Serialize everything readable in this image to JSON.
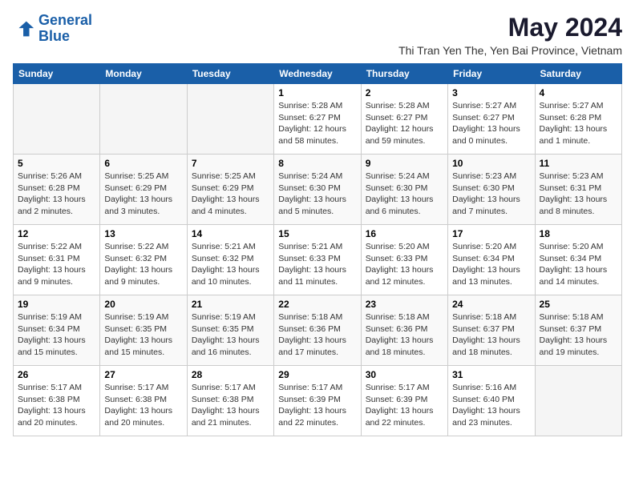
{
  "logo": {
    "line1": "General",
    "line2": "Blue"
  },
  "title": "May 2024",
  "location": "Thi Tran Yen The, Yen Bai Province, Vietnam",
  "days_of_week": [
    "Sunday",
    "Monday",
    "Tuesday",
    "Wednesday",
    "Thursday",
    "Friday",
    "Saturday"
  ],
  "weeks": [
    [
      {
        "day": "",
        "info": ""
      },
      {
        "day": "",
        "info": ""
      },
      {
        "day": "",
        "info": ""
      },
      {
        "day": "1",
        "info": "Sunrise: 5:28 AM\nSunset: 6:27 PM\nDaylight: 12 hours\nand 58 minutes."
      },
      {
        "day": "2",
        "info": "Sunrise: 5:28 AM\nSunset: 6:27 PM\nDaylight: 12 hours\nand 59 minutes."
      },
      {
        "day": "3",
        "info": "Sunrise: 5:27 AM\nSunset: 6:27 PM\nDaylight: 13 hours\nand 0 minutes."
      },
      {
        "day": "4",
        "info": "Sunrise: 5:27 AM\nSunset: 6:28 PM\nDaylight: 13 hours\nand 1 minute."
      }
    ],
    [
      {
        "day": "5",
        "info": "Sunrise: 5:26 AM\nSunset: 6:28 PM\nDaylight: 13 hours\nand 2 minutes."
      },
      {
        "day": "6",
        "info": "Sunrise: 5:25 AM\nSunset: 6:29 PM\nDaylight: 13 hours\nand 3 minutes."
      },
      {
        "day": "7",
        "info": "Sunrise: 5:25 AM\nSunset: 6:29 PM\nDaylight: 13 hours\nand 4 minutes."
      },
      {
        "day": "8",
        "info": "Sunrise: 5:24 AM\nSunset: 6:30 PM\nDaylight: 13 hours\nand 5 minutes."
      },
      {
        "day": "9",
        "info": "Sunrise: 5:24 AM\nSunset: 6:30 PM\nDaylight: 13 hours\nand 6 minutes."
      },
      {
        "day": "10",
        "info": "Sunrise: 5:23 AM\nSunset: 6:30 PM\nDaylight: 13 hours\nand 7 minutes."
      },
      {
        "day": "11",
        "info": "Sunrise: 5:23 AM\nSunset: 6:31 PM\nDaylight: 13 hours\nand 8 minutes."
      }
    ],
    [
      {
        "day": "12",
        "info": "Sunrise: 5:22 AM\nSunset: 6:31 PM\nDaylight: 13 hours\nand 9 minutes."
      },
      {
        "day": "13",
        "info": "Sunrise: 5:22 AM\nSunset: 6:32 PM\nDaylight: 13 hours\nand 9 minutes."
      },
      {
        "day": "14",
        "info": "Sunrise: 5:21 AM\nSunset: 6:32 PM\nDaylight: 13 hours\nand 10 minutes."
      },
      {
        "day": "15",
        "info": "Sunrise: 5:21 AM\nSunset: 6:33 PM\nDaylight: 13 hours\nand 11 minutes."
      },
      {
        "day": "16",
        "info": "Sunrise: 5:20 AM\nSunset: 6:33 PM\nDaylight: 13 hours\nand 12 minutes."
      },
      {
        "day": "17",
        "info": "Sunrise: 5:20 AM\nSunset: 6:34 PM\nDaylight: 13 hours\nand 13 minutes."
      },
      {
        "day": "18",
        "info": "Sunrise: 5:20 AM\nSunset: 6:34 PM\nDaylight: 13 hours\nand 14 minutes."
      }
    ],
    [
      {
        "day": "19",
        "info": "Sunrise: 5:19 AM\nSunset: 6:34 PM\nDaylight: 13 hours\nand 15 minutes."
      },
      {
        "day": "20",
        "info": "Sunrise: 5:19 AM\nSunset: 6:35 PM\nDaylight: 13 hours\nand 15 minutes."
      },
      {
        "day": "21",
        "info": "Sunrise: 5:19 AM\nSunset: 6:35 PM\nDaylight: 13 hours\nand 16 minutes."
      },
      {
        "day": "22",
        "info": "Sunrise: 5:18 AM\nSunset: 6:36 PM\nDaylight: 13 hours\nand 17 minutes."
      },
      {
        "day": "23",
        "info": "Sunrise: 5:18 AM\nSunset: 6:36 PM\nDaylight: 13 hours\nand 18 minutes."
      },
      {
        "day": "24",
        "info": "Sunrise: 5:18 AM\nSunset: 6:37 PM\nDaylight: 13 hours\nand 18 minutes."
      },
      {
        "day": "25",
        "info": "Sunrise: 5:18 AM\nSunset: 6:37 PM\nDaylight: 13 hours\nand 19 minutes."
      }
    ],
    [
      {
        "day": "26",
        "info": "Sunrise: 5:17 AM\nSunset: 6:38 PM\nDaylight: 13 hours\nand 20 minutes."
      },
      {
        "day": "27",
        "info": "Sunrise: 5:17 AM\nSunset: 6:38 PM\nDaylight: 13 hours\nand 20 minutes."
      },
      {
        "day": "28",
        "info": "Sunrise: 5:17 AM\nSunset: 6:38 PM\nDaylight: 13 hours\nand 21 minutes."
      },
      {
        "day": "29",
        "info": "Sunrise: 5:17 AM\nSunset: 6:39 PM\nDaylight: 13 hours\nand 22 minutes."
      },
      {
        "day": "30",
        "info": "Sunrise: 5:17 AM\nSunset: 6:39 PM\nDaylight: 13 hours\nand 22 minutes."
      },
      {
        "day": "31",
        "info": "Sunrise: 5:16 AM\nSunset: 6:40 PM\nDaylight: 13 hours\nand 23 minutes."
      },
      {
        "day": "",
        "info": ""
      }
    ]
  ]
}
